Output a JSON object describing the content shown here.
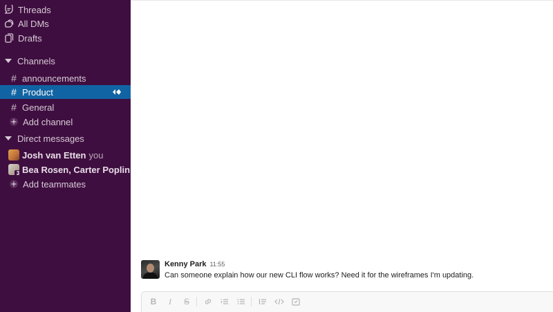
{
  "sidebar": {
    "nav": [
      {
        "label": "Threads",
        "icon": "threads-icon"
      },
      {
        "label": "All DMs",
        "icon": "all-dms-icon"
      },
      {
        "label": "Drafts",
        "icon": "drafts-icon"
      }
    ],
    "channels_header": "Channels",
    "channels": [
      {
        "label": "announcements",
        "active": false
      },
      {
        "label": "Product",
        "active": true
      },
      {
        "label": "General",
        "active": false
      }
    ],
    "add_channel": "Add channel",
    "dm_header": "Direct messages",
    "dms": [
      {
        "name": "Josh van Etten",
        "suffix": "you"
      },
      {
        "name": "Bea Rosen, Carter Poplin ...",
        "count": "3"
      }
    ],
    "add_teammates": "Add teammates",
    "colors": {
      "background": "#3f0e40",
      "active": "#1164a3"
    }
  },
  "message": {
    "author": "Kenny Park",
    "time": "11:55",
    "text": "Can someone explain how our new CLI flow works? Need it for the wireframes I'm updating."
  },
  "composer": {
    "toolbar": [
      "bold-icon",
      "italic-icon",
      "strikethrough-icon",
      "link-icon",
      "ordered-list-icon",
      "bulleted-list-icon",
      "blockquote-icon",
      "code-icon",
      "code-block-icon"
    ]
  }
}
